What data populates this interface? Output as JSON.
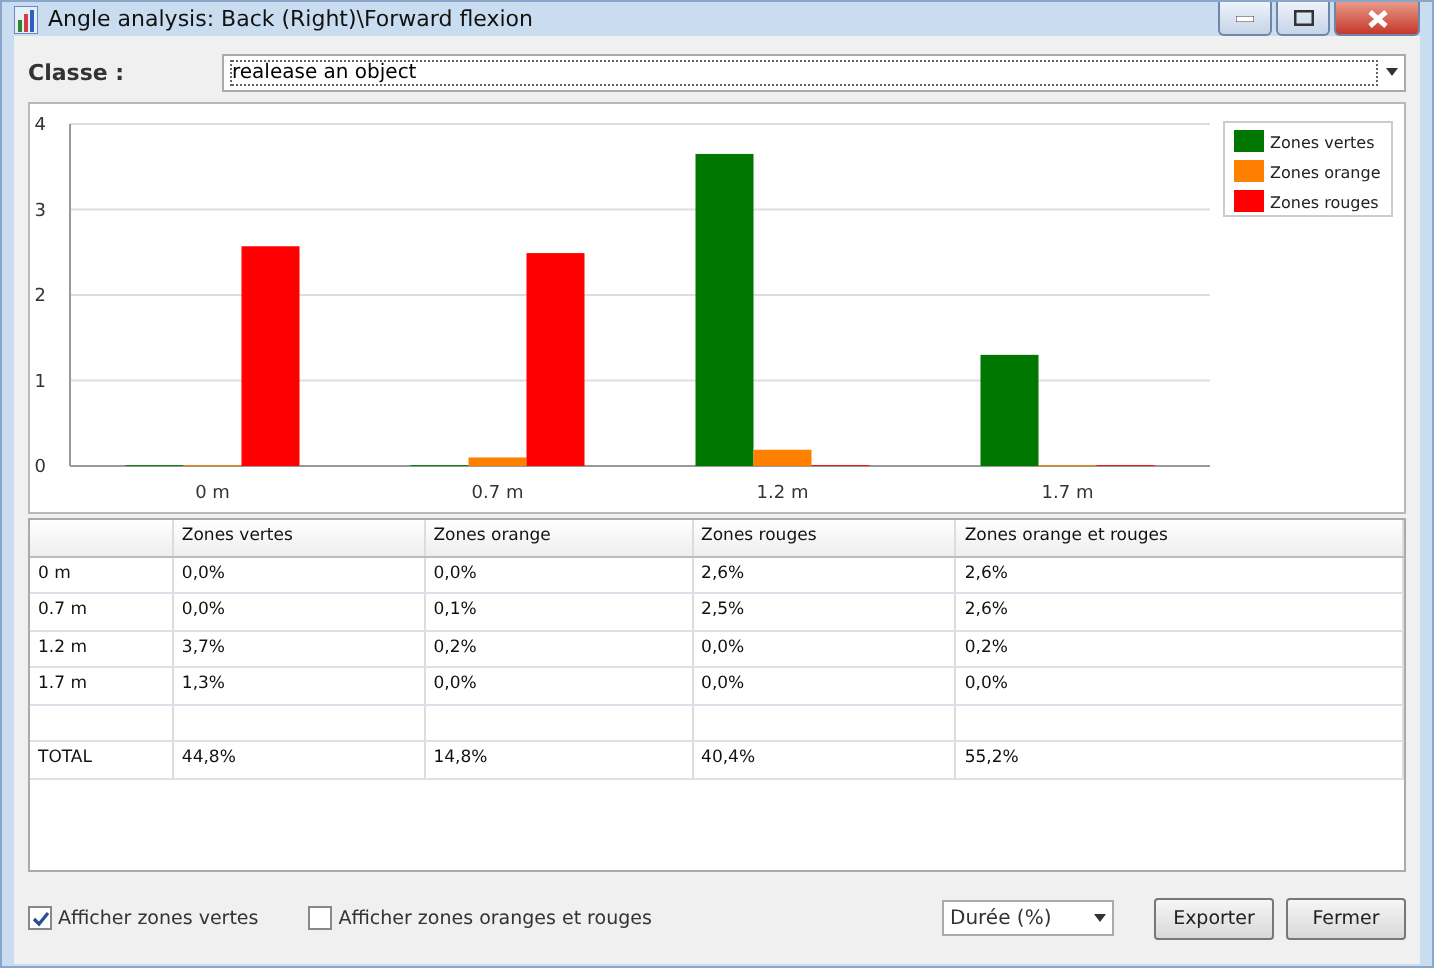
{
  "window": {
    "title": "Angle analysis: Back (Right)\\Forward flexion"
  },
  "classe": {
    "label": "Classe :",
    "value": "realease an object"
  },
  "chart": {
    "chart_data": {
      "type": "bar",
      "grid": true,
      "legend": true,
      "categories": [
        "0 m",
        "0.7 m",
        "1.2 m",
        "1.7 m"
      ],
      "ylim": [
        0,
        4
      ],
      "yticks": [
        0,
        1,
        2,
        3,
        4
      ],
      "series": [
        {
          "name": "Zones vertes",
          "color": "#007700",
          "values": [
            0.01,
            0.01,
            3.65,
            1.3
          ]
        },
        {
          "name": "Zones orange",
          "color": "#ff8000",
          "values": [
            0.01,
            0.1,
            0.19,
            0.01
          ]
        },
        {
          "name": "Zones rouges",
          "color": "#ff0000",
          "values": [
            2.57,
            2.49,
            0.01,
            0.01
          ]
        }
      ]
    }
  },
  "table": {
    "columns": [
      "",
      "Zones vertes",
      "Zones orange",
      "Zones rouges",
      "Zones orange et rouges"
    ],
    "rows": [
      [
        "0 m",
        "0,0%",
        "0,0%",
        "2,6%",
        "2,6%"
      ],
      [
        "0.7 m",
        "0,0%",
        "0,1%",
        "2,5%",
        "2,6%"
      ],
      [
        "1.2 m",
        "3,7%",
        "0,2%",
        "0,0%",
        "0,2%"
      ],
      [
        "1.7 m",
        "1,3%",
        "0,0%",
        "0,0%",
        "0,0%"
      ],
      [
        "",
        "",
        "",
        "",
        ""
      ],
      [
        "TOTAL",
        "44,8%",
        "14,8%",
        "40,4%",
        "55,2%"
      ]
    ]
  },
  "options": [
    {
      "label": "Afficher zones vertes",
      "checked": true
    },
    {
      "label": "Afficher zones oranges et rouges",
      "checked": false
    }
  ],
  "unit": {
    "value": "Durée (%)"
  },
  "buttons": [
    "Exporter",
    "Fermer"
  ]
}
